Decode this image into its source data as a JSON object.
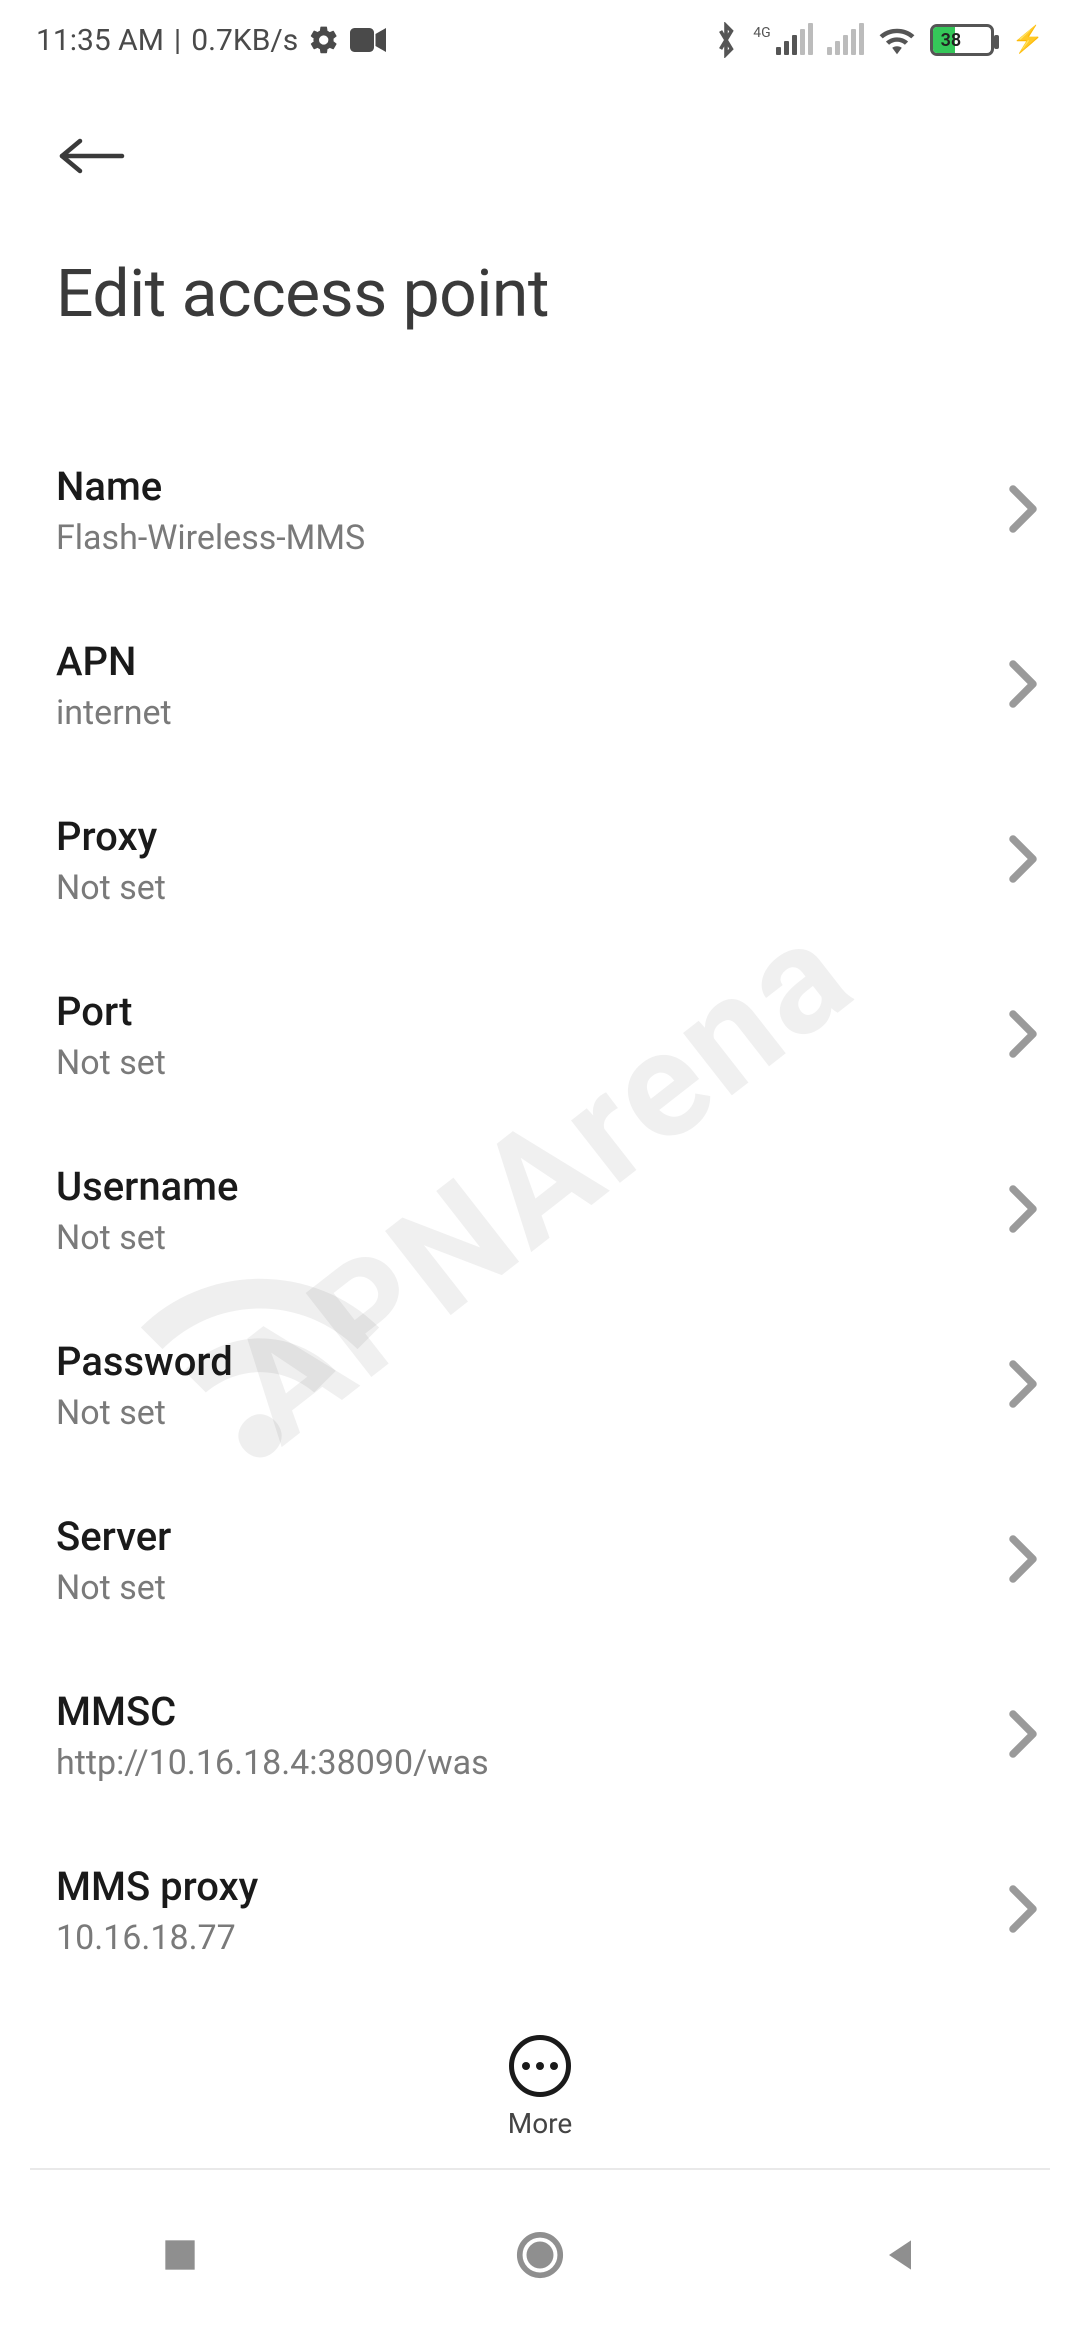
{
  "status_bar": {
    "time": "11:35 AM",
    "separator": "|",
    "data_rate": "0.7KB/s",
    "network_tag": "4G",
    "battery_pct": "38"
  },
  "header": {
    "title": "Edit access point"
  },
  "settings": [
    {
      "label": "Name",
      "value": "Flash-Wireless-MMS"
    },
    {
      "label": "APN",
      "value": "internet"
    },
    {
      "label": "Proxy",
      "value": "Not set"
    },
    {
      "label": "Port",
      "value": "Not set"
    },
    {
      "label": "Username",
      "value": "Not set"
    },
    {
      "label": "Password",
      "value": "Not set"
    },
    {
      "label": "Server",
      "value": "Not set"
    },
    {
      "label": "MMSC",
      "value": "http://10.16.18.4:38090/was"
    },
    {
      "label": "MMS proxy",
      "value": "10.16.18.77"
    }
  ],
  "more": {
    "label": "More"
  },
  "watermark": "APNArena"
}
